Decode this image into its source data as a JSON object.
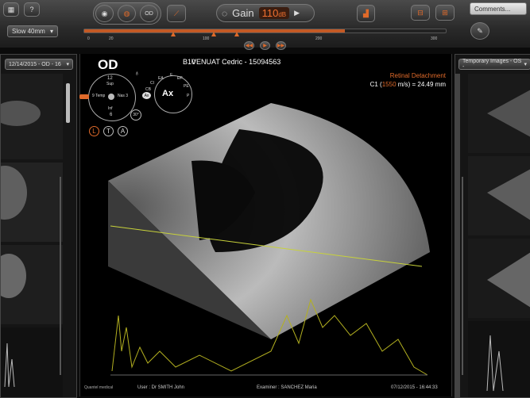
{
  "toolbar": {
    "gain_label": "Gain",
    "gain_value": "110",
    "gain_unit": "dB",
    "speed_label": "Slow 40mm",
    "comments_placeholder": "Comments..."
  },
  "scale": {
    "ticks": [
      "0",
      "20",
      "100",
      "200",
      "300"
    ],
    "fill_fraction": 0.72
  },
  "left_panel": {
    "date_dropdown": "12/14/2015 - OD - 16"
  },
  "right_panel": {
    "images_dropdown": "Temporary Images - OS -"
  },
  "main": {
    "eye": "OD",
    "probe": "B10",
    "patient": "VENUAT Cedric - 15094563",
    "diagnosis": "Retinal Detachment",
    "measure_prefix": "C1 (",
    "measure_speed": "1550",
    "measure_suffix": " m/s) = 24.49 mm",
    "clock_labels": [
      "12",
      "Sup",
      "9 Temp",
      "Nas 3",
      "Inf",
      "6"
    ],
    "orient_labels": [
      "EA",
      "E",
      "EP",
      "CI",
      "CB",
      "PE",
      "P",
      "Ax",
      "Ax"
    ],
    "angle": "30°",
    "ltabs": [
      "L",
      "T",
      "A"
    ],
    "user": "User : Dr SMITH John",
    "examiner": "Examiner : SANCHEZ Maria",
    "datetime": "07/12/2015 - 16:44:33",
    "brand": "Quantel medical"
  },
  "colors": {
    "accent": "#e06a2a",
    "measure_line": "#c8d23a"
  }
}
